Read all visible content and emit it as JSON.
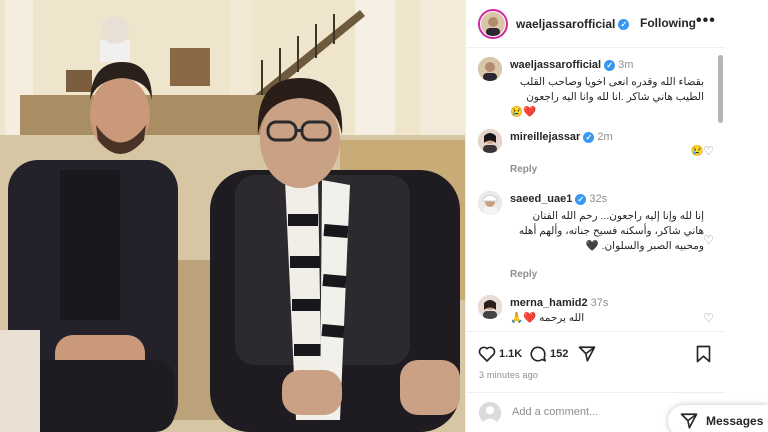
{
  "photo": {
    "alt_subject": "two-men-seated-photo",
    "colors": {
      "wall": "#e9dcc0",
      "floor": "#d9c9a6",
      "rug": "#b59a6a",
      "dark_clothes": "#1f1d22",
      "scarf_white": "#f2f0ea"
    }
  },
  "post": {
    "author": "waeljassarofficial",
    "follow_label": "Following",
    "more_label": "•••",
    "verified_mark": "✓"
  },
  "comments": [
    {
      "user": "waeljassarofficial",
      "time": "3m",
      "verified": true,
      "text": "بقضاء الله وقدره انعى اخويا وصاحب القلب الطيب هاني شاكر .انا لله وانا اليه راجعون",
      "emoji": "😢❤️"
    },
    {
      "user": "mireillejassar",
      "time": "2m",
      "verified": true,
      "text": "",
      "emoji": "😢",
      "reply": "Reply"
    },
    {
      "user": "saeed_uae1",
      "time": "32s",
      "verified": true,
      "text": "إنا لله وإنا إليه راجعون... رحم الله الفنان هاني شاكر، وأسكنه فسيح جناته، وألهم أهله ومحبيه الصبر والسلوان.",
      "emoji": "🖤",
      "reply": "Reply"
    },
    {
      "user": "merna_hamid2",
      "time": "37s",
      "verified": false,
      "text": "الله يرحمه",
      "emoji": "🙏❤️"
    }
  ],
  "actions": {
    "likes": "1.1K",
    "comments": "152",
    "time_ago": "3 minutes ago"
  },
  "add_comment": {
    "placeholder": "Add a comment..."
  },
  "messages": {
    "label": "Messages"
  },
  "icons": [
    "verified-icon",
    "heart-icon",
    "comment-icon",
    "share-icon",
    "bookmark-icon",
    "more-icon",
    "messages-icon"
  ]
}
